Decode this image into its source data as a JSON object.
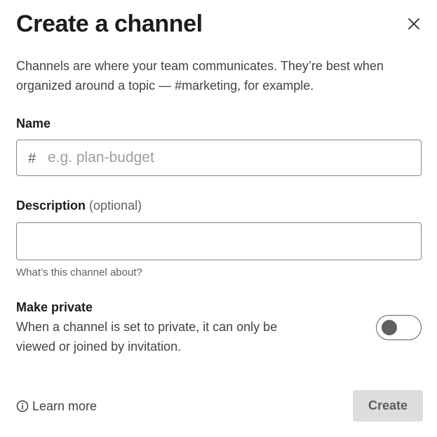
{
  "dialog": {
    "title": "Create a channel",
    "close_icon": "close-icon",
    "intro": "Channels are where your team communicates. They’re best when organized around a topic — #marketing, for example."
  },
  "name_field": {
    "label": "Name",
    "prefix": "#",
    "value": "",
    "placeholder": "e.g. plan-budget"
  },
  "description_field": {
    "label": "Description",
    "optional": "(optional)",
    "value": "",
    "placeholder": "",
    "hint": "What’s this channel about?"
  },
  "private_toggle": {
    "label": "Make private",
    "description": "When a channel is set to private, it can only be viewed or joined by invitation.",
    "state": "off"
  },
  "footer": {
    "learn_more": "Learn more",
    "learn_more_icon": "info-icon",
    "create_label": "Create"
  },
  "colors": {
    "text_primary": "#1d1c1d",
    "text_secondary": "#616061",
    "button_disabled_bg": "#dddddd",
    "input_border": "#868686"
  }
}
